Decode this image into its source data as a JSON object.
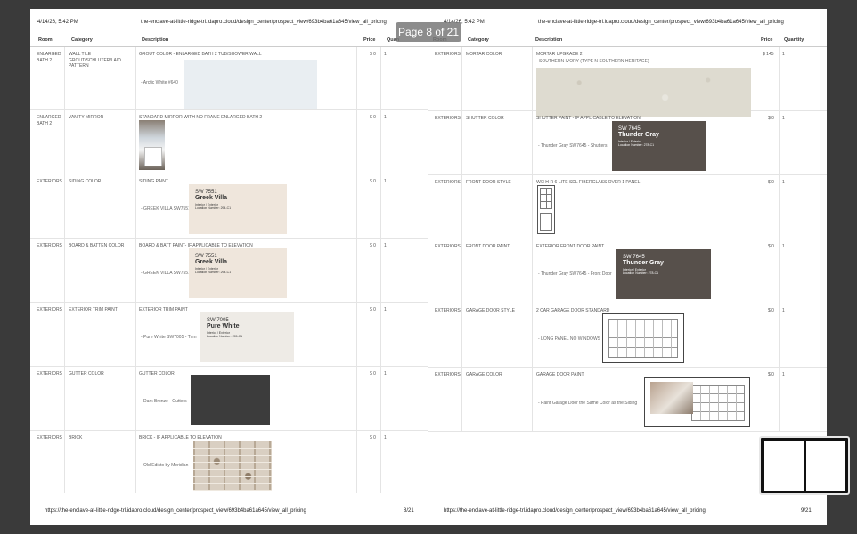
{
  "page_indicator": "Page 8 of 21",
  "left_page": {
    "header_date": "4/14/26, 5:42 PM",
    "header_url": "the-enclave-at-little-ridge-trl.idapro.cloud/design_center/prospect_view/693b4ba61a645/view_all_pricing",
    "footer_url": "https://the-enclave-at-little-ridge-trl.idapro.cloud/design_center/prospect_view/693b4ba61a645/view_all_pricing",
    "footer_page": "8/21",
    "columns": [
      "Room",
      "Category",
      "Description",
      "Price",
      "Quan"
    ],
    "rows": [
      {
        "room": "ENLARGED BATH 2",
        "category": "WALL TILE GROUT/SCHLUTER/LAID PATTERN",
        "description": "GROUT COLOR - ENLARGED BATH 2 TUB/SHOWER WALL",
        "caption": "- Arctic White #640",
        "price": "$ 0",
        "qty": "1"
      },
      {
        "room": "ENLARGED BATH 2",
        "category": "VANITY MIRROR",
        "description": "STANDARD MIRROR WITH NO FRAME ENLARGED BATH 2",
        "caption": "",
        "price": "$ 0",
        "qty": "1"
      },
      {
        "room": "EXTERIORS",
        "category": "SIDING COLOR",
        "description": "SIDING PAINT",
        "caption": "- GREEK VILLA SW7551",
        "price": "$ 0",
        "qty": "1",
        "card": {
          "code": "SW 7551",
          "name": "Greek Villa",
          "line1": "Interior / Exterior",
          "line2": "Location Number: 294-C1"
        }
      },
      {
        "room": "EXTERIORS",
        "category": "BOARD & BATTEN COLOR",
        "description": "BOARD & BATT PAINT- IF APPLICABLE TO ELEVATION",
        "caption": "- GREEK VILLA SW7551",
        "price": "$ 0",
        "qty": "1",
        "card": {
          "code": "SW 7551",
          "name": "Greek Villa",
          "line1": "Interior / Exterior",
          "line2": "Location Number: 294-C1"
        }
      },
      {
        "room": "EXTERIORS",
        "category": "EXTERIOR TRIM PAINT",
        "description": "EXTERIOR TRIM PAINT",
        "caption": "- Pure White SW7005 - Trim",
        "price": "$ 0",
        "qty": "1",
        "card": {
          "code": "SW 7005",
          "name": "Pure White",
          "line1": "Interior / Exterior",
          "line2": "Location Number: 255-C1"
        }
      },
      {
        "room": "EXTERIORS",
        "category": "GUTTER COLOR",
        "description": "GUTTER COLOR",
        "caption": "- Dark Bronze - Gutters",
        "price": "$ 0",
        "qty": "1"
      },
      {
        "room": "EXTERIORS",
        "category": "BRICK",
        "description": "BRICK - IF APPLICABLE TO ELEVATION",
        "caption": "- Old Edisto by Meridian",
        "price": "$ 0",
        "qty": "1"
      }
    ]
  },
  "right_page": {
    "header_date": "4/14/26, 5:42 PM",
    "header_url": "the-enclave-at-little-ridge-trl.idapro.cloud/design_center/prospect_view/693b4ba61a645/view_all_pricing",
    "footer_url": "https://the-enclave-at-little-ridge-trl.idapro.cloud/design_center/prospect_view/693b4ba61a645/view_all_pricing",
    "footer_page": "9/21",
    "columns": [
      "Room",
      "Category",
      "Description",
      "Price",
      "Quantity"
    ],
    "rows": [
      {
        "room": "EXTERIORS",
        "category": "MORTAR COLOR",
        "description": "MORTAR UPGRADE 2",
        "caption": "- SOUTHERN IVORY (TYPE N SOUTHERN HERITAGE)",
        "price": "$ 145",
        "qty": "1"
      },
      {
        "room": "EXTERIORS",
        "category": "SHUTTER COLOR",
        "description": "SHUTTER PAINT - IF APPLICABLE TO ELEVATION",
        "caption": "- Thunder Gray SW7645 - Shutters",
        "price": "$ 0",
        "qty": "1",
        "card": {
          "code": "SW 7645",
          "name": "Thunder Gray",
          "line1": "Interior / Exterior",
          "line2": "Location Number: 278-C1"
        }
      },
      {
        "room": "EXTERIORS",
        "category": "FRONT DOOR STYLE",
        "description": "W/3 H-R 6-LITE SDL FIBERGLASS OVER 1 PANEL",
        "caption": "",
        "price": "$ 0",
        "qty": "1"
      },
      {
        "room": "EXTERIORS",
        "category": "FRONT DOOR PAINT",
        "description": "EXTERIOR FRONT DOOR PAINT",
        "caption": "- Thunder Gray SW7645 - Front Door",
        "price": "$ 0",
        "qty": "1",
        "card": {
          "code": "SW 7645",
          "name": "Thunder Gray",
          "line1": "Interior / Exterior",
          "line2": "Location Number: 278-C1"
        }
      },
      {
        "room": "EXTERIORS",
        "category": "GARAGE DOOR STYLE",
        "description": "2 CAR GARAGE DOOR STANDARD",
        "caption": "- LONG PANEL NO WINDOWS",
        "price": "$ 0",
        "qty": "1"
      },
      {
        "room": "EXTERIORS",
        "category": "GARAGE COLOR",
        "description": "GARAGE DOOR PAINT",
        "caption": "- Paint Garage Door the Same Color as the Siding",
        "price": "$ 0",
        "qty": "1"
      }
    ]
  },
  "colors": {
    "arctic_white": "#e9eef2",
    "greek_villa": "#efe6dc",
    "pure_white": "#eeebe6",
    "dark_bronze": "#3c3c3c",
    "thunder_gray": "#57504b",
    "mortar": "#dedbd0"
  }
}
